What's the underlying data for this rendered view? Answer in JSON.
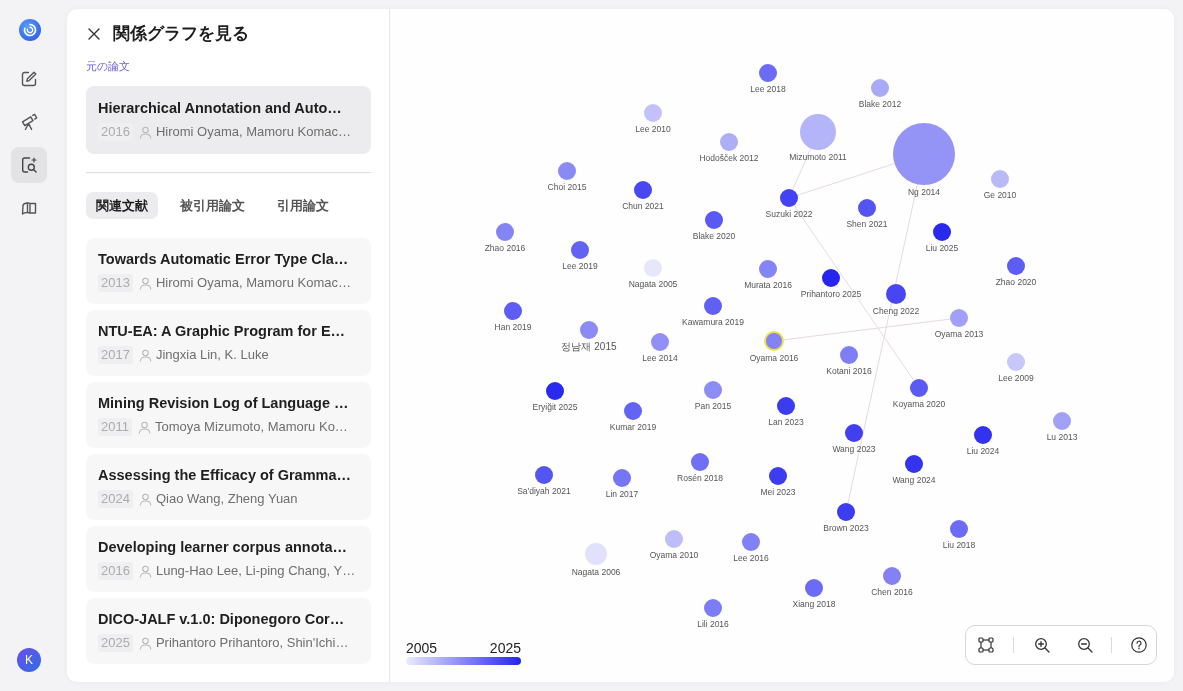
{
  "nav": [
    {
      "kind": "compose",
      "selected": false
    },
    {
      "kind": "announce",
      "selected": false
    },
    {
      "kind": "explore",
      "selected": true
    },
    {
      "kind": "library",
      "selected": false
    }
  ],
  "user": {
    "initial": "K"
  },
  "panel": {
    "title": "関係グラフを見る",
    "section_label": "元の論文",
    "original": {
      "title": "Hierarchical Annotation and Auto…",
      "year": "2016",
      "authors": "Hiromi Oyama, Mamoru Komac…"
    },
    "tabs": [
      {
        "label": "関連文献",
        "selected": true
      },
      {
        "label": "被引用論文",
        "selected": false
      },
      {
        "label": "引用論文",
        "selected": false
      }
    ],
    "papers": [
      {
        "title": "Towards Automatic Error Type Cla…",
        "year": "2013",
        "authors": "Hiromi Oyama, Mamoru Komac…"
      },
      {
        "title": "NTU-EA: A Graphic Program for E…",
        "year": "2017",
        "authors": "Jingxia Lin, K. Luke"
      },
      {
        "title": "Mining Revision Log of Language …",
        "year": "2011",
        "authors": "Tomoya Mizumoto, Mamoru Ko…"
      },
      {
        "title": "Assessing the Efficacy of Gramma…",
        "year": "2024",
        "authors": "Qiao Wang, Zheng Yuan"
      },
      {
        "title": "Developing learner corpus annota…",
        "year": "2016",
        "authors": "Lung-Hao Lee, Li-ping Chang, Y…"
      },
      {
        "title": "DICO-JALF v.1.0: Diponegoro Cor…",
        "year": "2025",
        "authors": "Prihantoro Prihantoro, Shin'Ichi…"
      }
    ]
  },
  "graph": {
    "nodes": [
      {
        "label": "Lee 2018",
        "color": "#6b6bf5",
        "selected": false
      },
      {
        "label": "Blake 2012",
        "color": "#a9a9f7",
        "selected": false
      },
      {
        "label": "Lee 2010",
        "color": "#c2c2f9",
        "selected": false
      },
      {
        "label": "Hodošček 2012",
        "color": "#aeaef7",
        "selected": false
      },
      {
        "label": "Mizumoto 2011",
        "color": "#b4b4f8",
        "selected": false
      },
      {
        "label": "Choi 2015",
        "color": "#8a8af5",
        "selected": false
      },
      {
        "label": "Ng 2014",
        "color": "#9494f6",
        "selected": false
      },
      {
        "label": "Ge 2010",
        "color": "#b9b9f8",
        "selected": false
      },
      {
        "label": "Chun 2021",
        "color": "#4848f2",
        "selected": false
      },
      {
        "label": "Suzuki 2022",
        "color": "#4343f1",
        "selected": false
      },
      {
        "label": "Shen 2021",
        "color": "#5454f2",
        "selected": false
      },
      {
        "label": "Blake 2020",
        "color": "#5959f3",
        "selected": false
      },
      {
        "label": "Zhao 2016",
        "color": "#8484f5",
        "selected": false
      },
      {
        "label": "Liu 2025",
        "color": "#2a2aef",
        "selected": false
      },
      {
        "label": "Lee 2019",
        "color": "#6262f4",
        "selected": false
      },
      {
        "label": "Nagata 2005",
        "color": "#e7e7fb",
        "selected": false
      },
      {
        "label": "Murata 2016",
        "color": "#8585f5",
        "selected": false
      },
      {
        "label": "Zhao 2020",
        "color": "#5d5df4",
        "selected": false
      },
      {
        "label": "Prihantoro 2025",
        "color": "#2525ee",
        "selected": false
      },
      {
        "label": "Cheng 2022",
        "color": "#4747f1",
        "selected": false
      },
      {
        "label": "Han 2019",
        "color": "#5d5df4",
        "selected": false
      },
      {
        "label": "Kawamura 2019",
        "color": "#6060f4",
        "selected": false
      },
      {
        "label": "Oyama 2013",
        "color": "#a0a0f6",
        "selected": false
      },
      {
        "label": "정남재 2015",
        "color": "#8b8bf5",
        "selected": false
      },
      {
        "label": "Lee 2014",
        "color": "#9090f6",
        "selected": false
      },
      {
        "label": "Oyama 2016",
        "color": "#8383f5",
        "selected": true
      },
      {
        "label": "Kotani 2016",
        "color": "#7f7ff5",
        "selected": false
      },
      {
        "label": "Lee 2009",
        "color": "#c7c7f9",
        "selected": false
      },
      {
        "label": "Eryiğit 2025",
        "color": "#2a2aef",
        "selected": false
      },
      {
        "label": "Pan 2015",
        "color": "#8c8cf5",
        "selected": false
      },
      {
        "label": "Koyama 2020",
        "color": "#5b5bf3",
        "selected": false
      },
      {
        "label": "Kumar 2019",
        "color": "#6464f4",
        "selected": false
      },
      {
        "label": "Lan 2023",
        "color": "#3b3bf0",
        "selected": false
      },
      {
        "label": "Lu 2013",
        "color": "#a1a1f6",
        "selected": false
      },
      {
        "label": "Wang 2023",
        "color": "#4040f0",
        "selected": false
      },
      {
        "label": "Liu 2024",
        "color": "#3232ef",
        "selected": false
      },
      {
        "label": "Rosén 2018",
        "color": "#7070f4",
        "selected": false
      },
      {
        "label": "Wang 2024",
        "color": "#3434ef",
        "selected": false
      },
      {
        "label": "Sa'diyah 2021",
        "color": "#5555f2",
        "selected": false
      },
      {
        "label": "Lin 2017",
        "color": "#7676f5",
        "selected": false
      },
      {
        "label": "Mei 2023",
        "color": "#3c3cf0",
        "selected": false
      },
      {
        "label": "Brown 2023",
        "color": "#3c3cf0",
        "selected": false
      },
      {
        "label": "Liu 2018",
        "color": "#6b6bf5",
        "selected": false
      },
      {
        "label": "Oyama 2010",
        "color": "#bdbdf8",
        "selected": false
      },
      {
        "label": "Lee 2016",
        "color": "#8181f5",
        "selected": false
      },
      {
        "label": "Nagata 2006",
        "color": "#e1e1fb",
        "selected": false
      },
      {
        "label": "Chen 2016",
        "color": "#8282f5",
        "selected": false
      },
      {
        "label": "Xiang 2018",
        "color": "#6b6bf5",
        "selected": false
      },
      {
        "label": "Lili 2016",
        "color": "#7c7cf5",
        "selected": false
      }
    ],
    "legend": {
      "min_label": "2005",
      "max_label": "2025"
    }
  }
}
